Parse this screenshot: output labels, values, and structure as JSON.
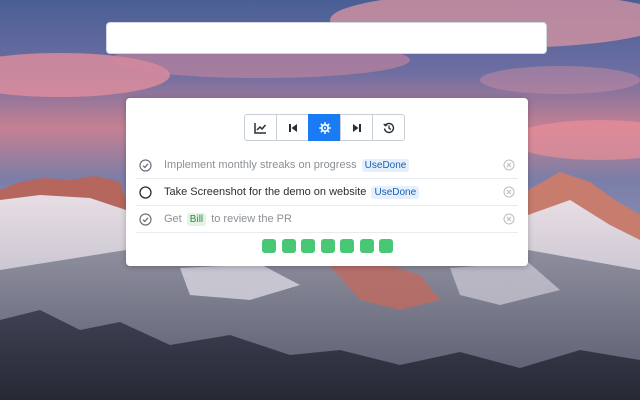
{
  "search": {
    "value": ""
  },
  "toolbar": {
    "buttons": [
      {
        "icon": "chart-line-icon",
        "active": false
      },
      {
        "icon": "skip-previous-icon",
        "active": false
      },
      {
        "icon": "settings-gear-icon",
        "active": true
      },
      {
        "icon": "skip-next-icon",
        "active": false
      },
      {
        "icon": "history-icon",
        "active": false
      }
    ]
  },
  "todos": [
    {
      "text": "Implement monthly streaks on progress",
      "tag": "UseDone",
      "done": true
    },
    {
      "text": "Take Screenshot for the demo on website",
      "tag": "UseDone",
      "done": false
    },
    {
      "text_before": "Get",
      "tag": "Bill",
      "text_after": "to review the PR",
      "done": true
    }
  ],
  "streak": {
    "days_completed": 7,
    "days_total": 7
  },
  "colors": {
    "accent": "#1a7cf5",
    "streak_green": "#48c774",
    "tag_blue_bg": "#e6f0fc",
    "tag_green_bg": "#e3f4e6"
  }
}
